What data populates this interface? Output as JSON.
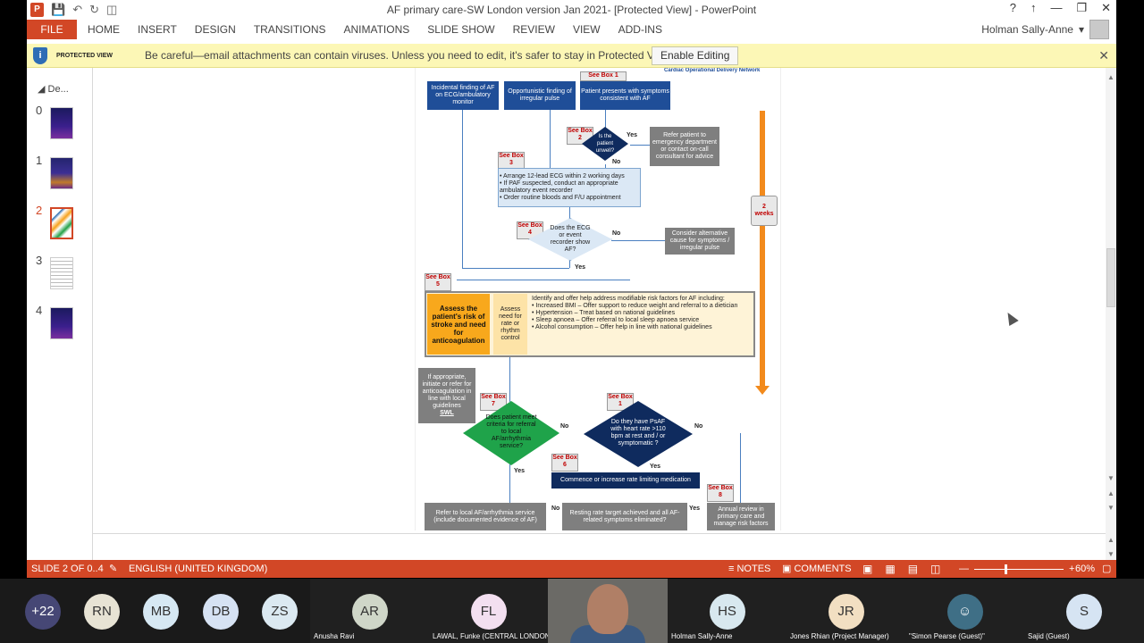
{
  "window": {
    "title": "AF primary care-SW London version Jan 2021- [Protected View] - PowerPoint",
    "controls": [
      "?",
      "↑",
      "—",
      "❐",
      "✕"
    ]
  },
  "ribbon": {
    "file": "FILE",
    "tabs": [
      "HOME",
      "INSERT",
      "DESIGN",
      "TRANSITIONS",
      "ANIMATIONS",
      "SLIDE SHOW",
      "REVIEW",
      "VIEW",
      "ADD-INS"
    ],
    "user": "Holman Sally-Anne"
  },
  "protected_view": {
    "label": "PROTECTED VIEW",
    "message": "Be careful—email attachments can contain viruses. Unless you need to edit, it's safer to stay in Protected View.",
    "button": "Enable Editing",
    "close": "✕"
  },
  "thumbnails": {
    "section": "De...",
    "numbers": [
      "0",
      "1",
      "2",
      "3",
      "4"
    ],
    "selected": 2
  },
  "slide": {
    "header": "Cardiac Operational Delivery Network",
    "boxes": {
      "incidental": "Incidental finding of AF on ECG/ambulatory monitor",
      "opportunistic": "Opportunistic finding of irregular pulse",
      "presents": "Patient presents with symptoms consistent with AF",
      "unwell": "Is the patient unwell?",
      "refer": "Refer patient to emergency department or contact on-call consultant for advice",
      "arrange": "• Arrange 12-lead ECG within 2 working days\n• If PAF suspected, conduct an appropriate ambulatory event recorder\n• Order routine bloods and F/U appointment",
      "ecg": "Does the ECG or event recorder show AF?",
      "alt": "Consider alternative cause for symptoms / irregular pulse",
      "two_weeks": "2 weeks",
      "assess_stroke": "Assess the patient's risk of stroke and need for anticoagulation",
      "assess_rate": "Assess need for rate or rhythm control",
      "risk_intro": "Identify and offer help address modifiable risk factors for AF including:",
      "risk_items": [
        "Increased BMI – Offer support to reduce weight and referral to a dietician",
        "Hypertension – Treat based on national guidelines",
        "Sleep apnoea – Offer referral to local sleep apnoea service",
        "Alcohol consumption – Offer help in line with national guidelines"
      ],
      "initiate": "If appropriate, initiate or refer for anticoagulation in line with local guidelines",
      "swl": "SWL",
      "criteria": "Does patient meet criteria for referral to local AF/arrhythmia service?",
      "psaf": "Do they have PsAF with heart rate >110 bpm at rest and / or symptomatic ?",
      "commence": "Commence or increase rate limiting medication",
      "refer_local": "Refer to local AF/arrhythmia service (include documented evidence of AF)",
      "resting": "Resting rate target achieved and all AF-related symptoms eliminated?",
      "annual": "Annual review in primary care and manage risk factors"
    },
    "tags": [
      "See Box 1",
      "See Box 2",
      "See Box 3",
      "See Box 4",
      "See Box 5",
      "See Box 7",
      "See Box 1",
      "See Box 6",
      "See Box 8"
    ],
    "labels": {
      "yes": "Yes",
      "no": "No"
    }
  },
  "statusbar": {
    "slide_info": "SLIDE 2 OF 0..4",
    "language": "ENGLISH (UNITED KINGDOM)",
    "notes": "NOTES",
    "comments": "COMMENTS",
    "zoom": "60%"
  },
  "meeting": {
    "overflow": "+22",
    "participants": [
      {
        "initials": "RN",
        "name": "",
        "color": "#e7e3d4"
      },
      {
        "initials": "MB",
        "name": "",
        "color": "#d6e8f3"
      },
      {
        "initials": "DB",
        "name": "",
        "color": "#d6e2f3"
      },
      {
        "initials": "ZS",
        "name": "",
        "color": "#dbe9f1"
      },
      {
        "initials": "AR",
        "name": "Anusha Ravi",
        "color": "#cfd6c8"
      },
      {
        "initials": "FL",
        "name": "LAWAL, Funke (CENTRAL LONDON...",
        "color": "#f3dff0"
      },
      {
        "initials": "HS",
        "name": "Holman Sally-Anne",
        "color": "#d8e8ef"
      },
      {
        "initials": "JR",
        "name": "Jones Rhian (Project Manager)",
        "color": "#f2dfc2"
      },
      {
        "initials": "",
        "name": "\"Simon Pearse (Guest)\"",
        "color": "#3f6f86"
      },
      {
        "initials": "S",
        "name": "Sajid (Guest)",
        "color": "#d6e4f3"
      }
    ]
  }
}
